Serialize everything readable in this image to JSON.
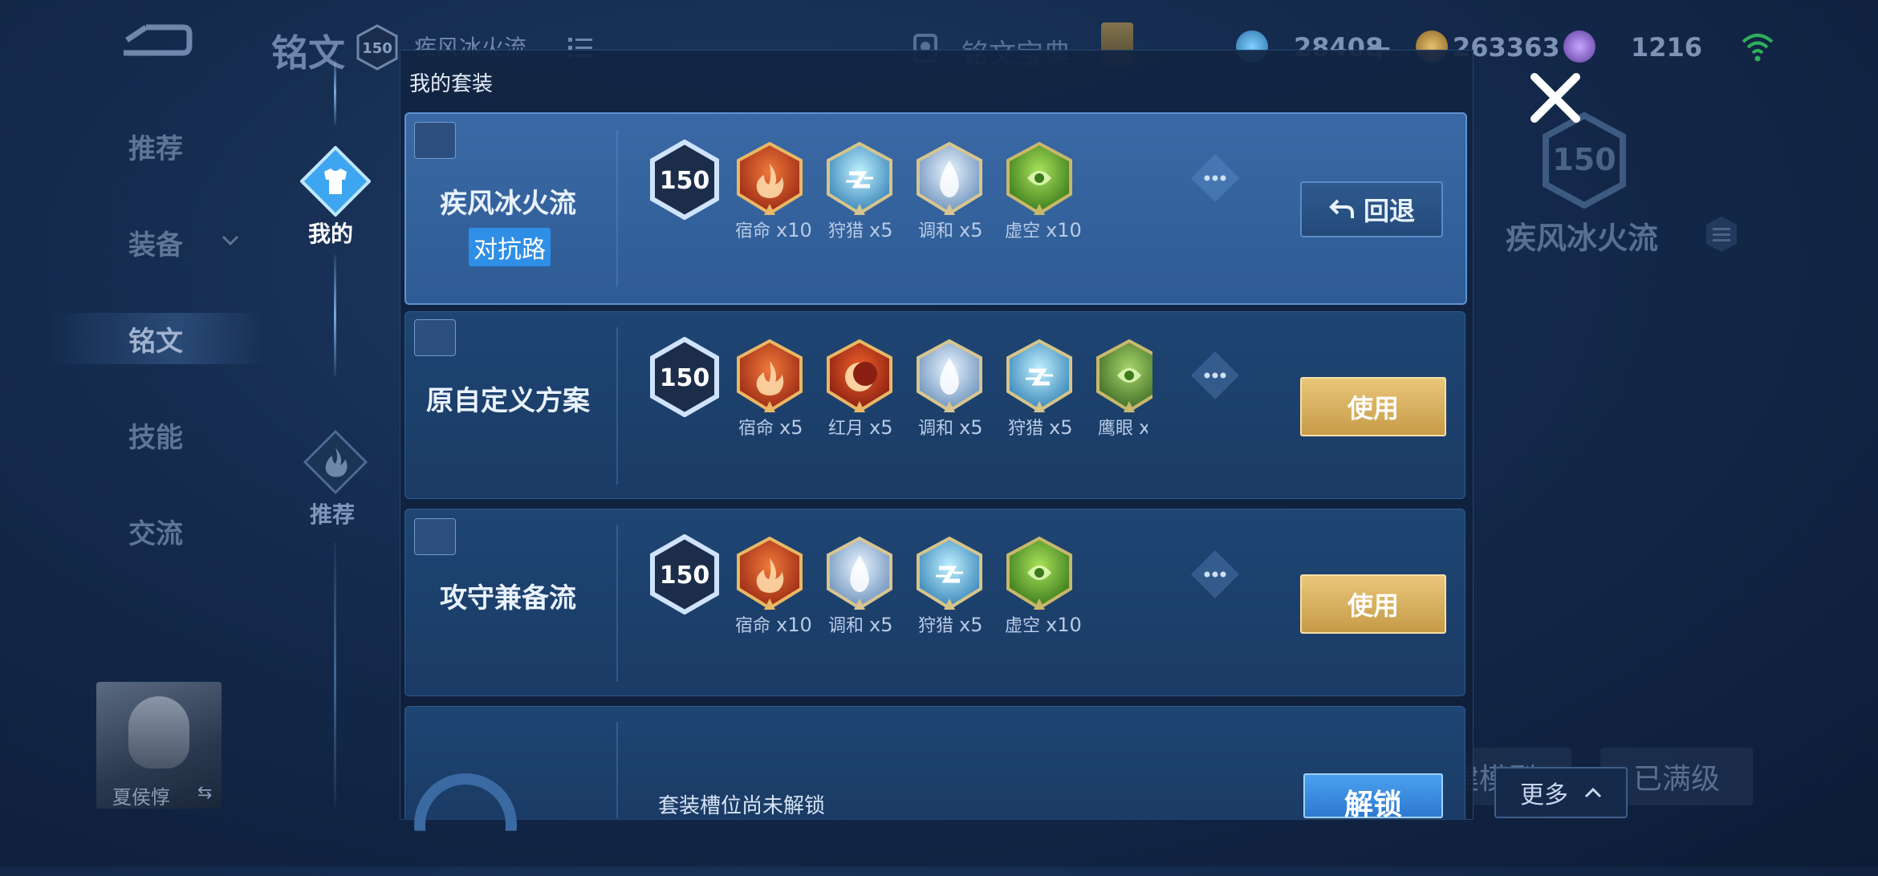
{
  "topbar": {
    "title": "铭文",
    "level": "150",
    "current_plan": "疾风冰火流",
    "codex_label": "铭文宝典",
    "currencies": [
      {
        "name": "blue-crystal",
        "value": "28408",
        "color": "#4fb3e8"
      },
      {
        "name": "gold-coin",
        "value": "263363",
        "color": "#c9a24a"
      },
      {
        "name": "purple-gem",
        "value": "1216",
        "color": "#9b6fe0"
      }
    ]
  },
  "leftnav": {
    "items": [
      {
        "label": "推荐"
      },
      {
        "label": "装备"
      },
      {
        "label": "铭文"
      },
      {
        "label": "技能"
      },
      {
        "label": "交流"
      }
    ],
    "active": "铭文"
  },
  "track": {
    "mine_label": "我的",
    "recommend_label": "推荐"
  },
  "avatar": {
    "hero_name": "夏侯惇",
    "swap_glyph": "⇆"
  },
  "modal": {
    "title": "我的套装",
    "cards": [
      {
        "name": "疾风冰火流",
        "tag": "对抗路",
        "level": "150",
        "runes": [
          {
            "label": "宿命",
            "count": "x10",
            "type": "fire"
          },
          {
            "label": "狩猎",
            "count": "x5",
            "type": "ice"
          },
          {
            "label": "调和",
            "count": "x5",
            "type": "drop"
          },
          {
            "label": "虚空",
            "count": "x10",
            "type": "green"
          }
        ],
        "action": "回退",
        "active": true
      },
      {
        "name": "原自定义方案",
        "level": "150",
        "runes": [
          {
            "label": "宿命",
            "count": "x5",
            "type": "fire"
          },
          {
            "label": "红月",
            "count": "x5",
            "type": "moon"
          },
          {
            "label": "调和",
            "count": "x5",
            "type": "drop"
          },
          {
            "label": "狩猎",
            "count": "x5",
            "type": "ice"
          },
          {
            "label": "鹰眼",
            "count": "x",
            "type": "eye"
          }
        ],
        "action": "使用"
      },
      {
        "name": "攻守兼备流",
        "level": "150",
        "runes": [
          {
            "label": "宿命",
            "count": "x10",
            "type": "fire"
          },
          {
            "label": "调和",
            "count": "x5",
            "type": "drop"
          },
          {
            "label": "狩猎",
            "count": "x5",
            "type": "ice"
          },
          {
            "label": "虚空",
            "count": "x10",
            "type": "green"
          }
        ],
        "action": "使用"
      }
    ],
    "locked": {
      "text": "套装槽位尚未解锁",
      "action": "解锁"
    }
  },
  "right_panel": {
    "level": "150",
    "plan_name": "疾风冰火流",
    "more_label": "更多",
    "maxed_label": "已满级",
    "build_label": "建模型"
  }
}
